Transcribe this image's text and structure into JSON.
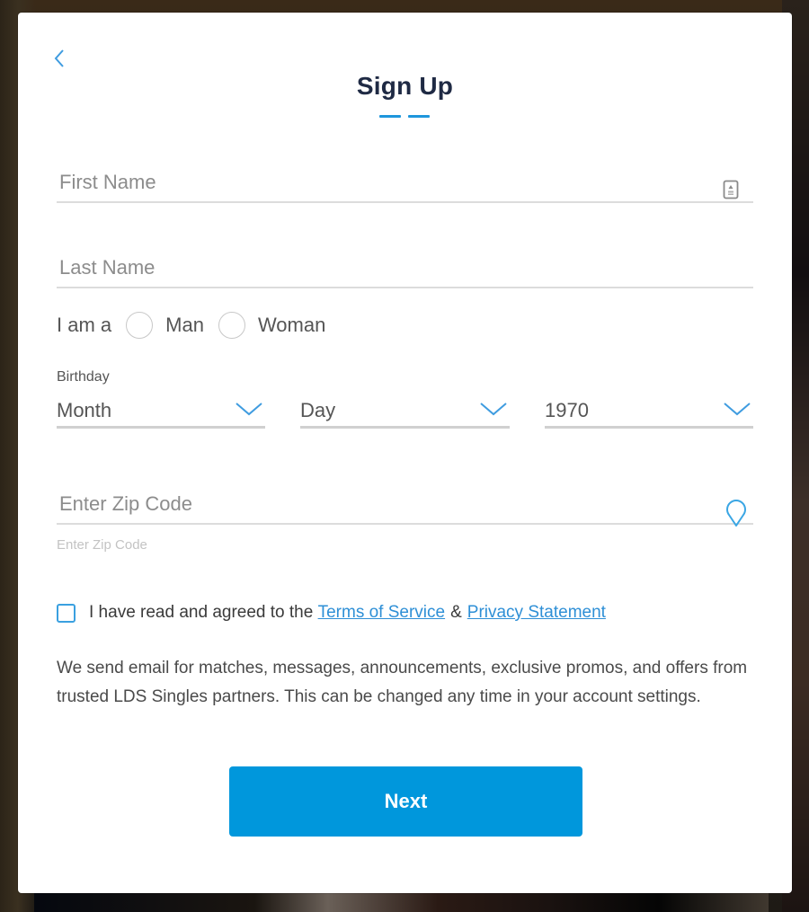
{
  "modal": {
    "title": "Sign Up",
    "back_icon": "chevron-left-icon",
    "step_count": 2
  },
  "form": {
    "first_name": {
      "placeholder": "First Name",
      "value": "",
      "icon": "contact-card-icon"
    },
    "last_name": {
      "placeholder": "Last Name",
      "value": ""
    },
    "gender": {
      "label": "I am a",
      "options": [
        "Man",
        "Woman"
      ],
      "selected": null
    },
    "birthday": {
      "label": "Birthday",
      "month": "Month",
      "day": "Day",
      "year": "1970"
    },
    "zip": {
      "placeholder": "Enter Zip Code",
      "value": "",
      "hint": "Enter Zip Code",
      "icon": "location-pin-icon"
    },
    "agree": {
      "checked": false,
      "text": "I have read and agreed to the",
      "terms_link": "Terms of Service",
      "amp": "&",
      "privacy_link": "Privacy Statement"
    },
    "notice": "We send email for matches, messages, announcements, exclusive promos, and offers from trusted LDS Singles partners. This can be changed any time in your account settings.",
    "next_button": "Next"
  },
  "colors": {
    "accent": "#0097dc",
    "title": "#1f2a44",
    "link": "#2e8fd6"
  }
}
